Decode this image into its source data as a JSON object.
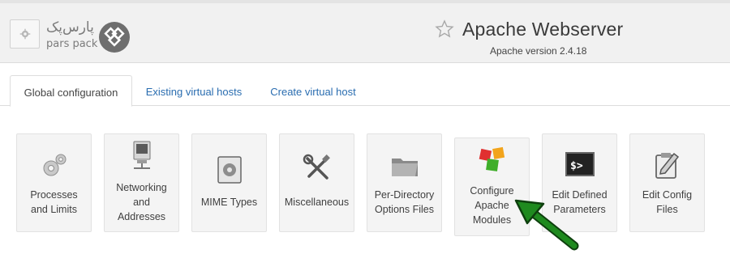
{
  "header": {
    "title": "Apache Webserver",
    "subtitle": "Apache version 2.4.18",
    "logo_fa": "پارس‌پک",
    "logo_en": "pars pack"
  },
  "tabs": [
    {
      "label": "Global configuration",
      "active": true
    },
    {
      "label": "Existing virtual hosts",
      "active": false
    },
    {
      "label": "Create virtual host",
      "active": false
    }
  ],
  "modules": [
    {
      "label_lines": [
        "Processes",
        "and Limits"
      ],
      "icon": "gears-icon"
    },
    {
      "label_lines": [
        "Networking",
        "and",
        "Addresses"
      ],
      "icon": "network-computer-icon"
    },
    {
      "label_lines": [
        "MIME Types"
      ],
      "icon": "mime-types-icon"
    },
    {
      "label_lines": [
        "Miscellaneous"
      ],
      "icon": "tools-icon"
    },
    {
      "label_lines": [
        "Per-Directory",
        "Options Files"
      ],
      "icon": "folder-icon"
    },
    {
      "label_lines": [
        "Configure",
        "Apache",
        "Modules"
      ],
      "icon": "modules-cubes-icon"
    },
    {
      "label_lines": [
        "Edit Defined",
        "Parameters"
      ],
      "icon": "terminal-icon"
    },
    {
      "label_lines": [
        "Edit Config",
        "Files"
      ],
      "icon": "edit-clipboard-icon"
    }
  ],
  "colors": {
    "link": "#2a6db0",
    "arrow": "#1f7a1f"
  }
}
